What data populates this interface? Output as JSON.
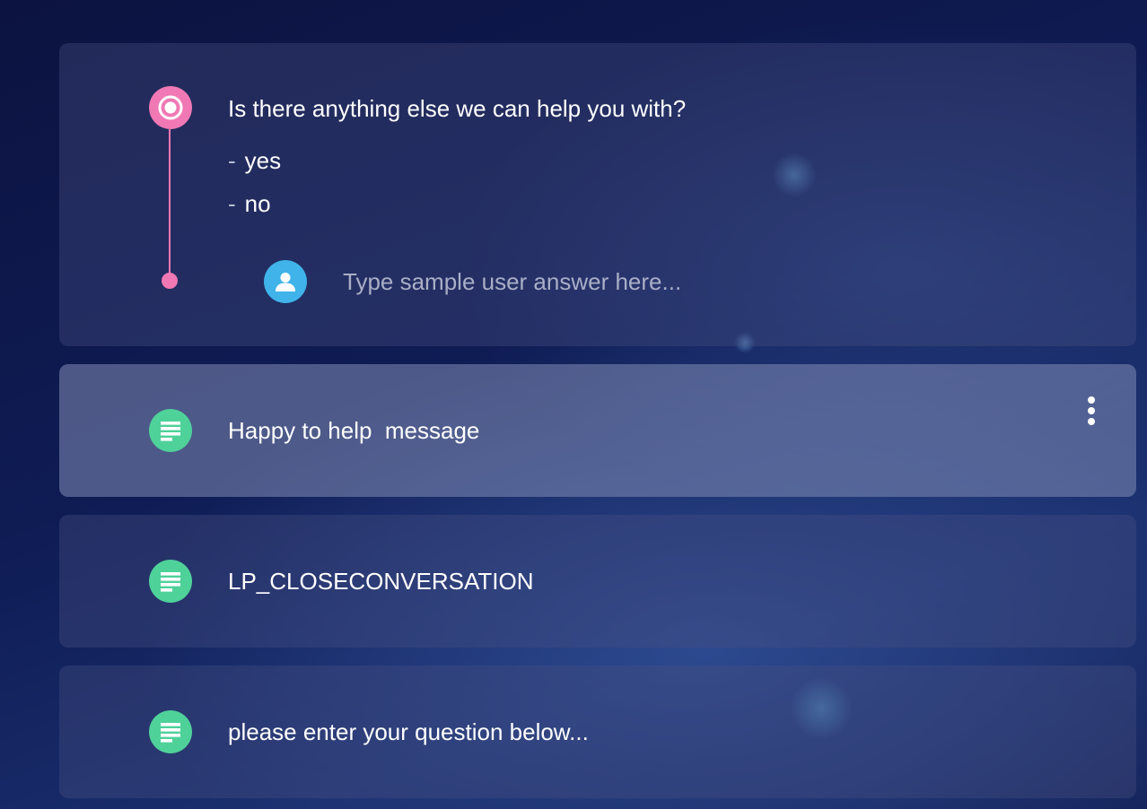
{
  "question_card": {
    "question": "Is there anything else we can help you with?",
    "options": [
      {
        "dash": "-",
        "label": "yes"
      },
      {
        "dash": "-",
        "label": "no"
      }
    ],
    "answer_placeholder": "Type sample user answer here..."
  },
  "message_cards": [
    {
      "text": "Happy to help  message",
      "icon": "text-lines-icon",
      "highlighted": true
    },
    {
      "text": "LP_CLOSECONVERSATION",
      "icon": "text-lines-icon"
    },
    {
      "text": "please enter your question below...",
      "icon": "text-lines-icon"
    }
  ],
  "colors": {
    "question_accent": "#f078b4",
    "user_accent": "#3fb3ea",
    "message_accent": "#4fd19a"
  }
}
